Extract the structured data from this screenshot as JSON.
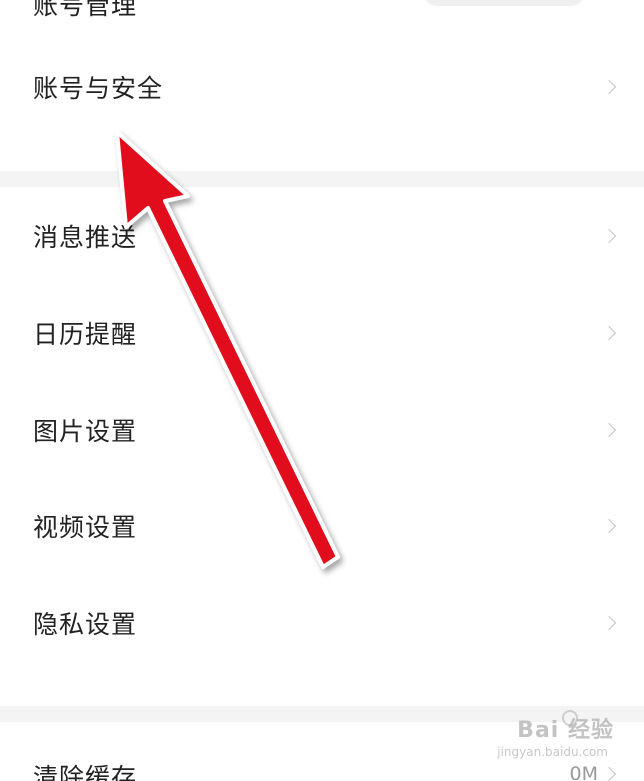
{
  "settings": {
    "top_partial_label": "账号管理",
    "items": [
      {
        "label": "账号与安全"
      },
      {
        "label": "消息推送"
      },
      {
        "label": "日历提醒"
      },
      {
        "label": "图片设置"
      },
      {
        "label": "视频设置"
      },
      {
        "label": "隐私设置"
      },
      {
        "label": "清除缓存",
        "value": "0M"
      }
    ]
  },
  "overlay": {
    "watermark": "Bai 经验",
    "watermark_url": "jingyan.baidu.com",
    "arrow_color": "#e10d1e"
  }
}
